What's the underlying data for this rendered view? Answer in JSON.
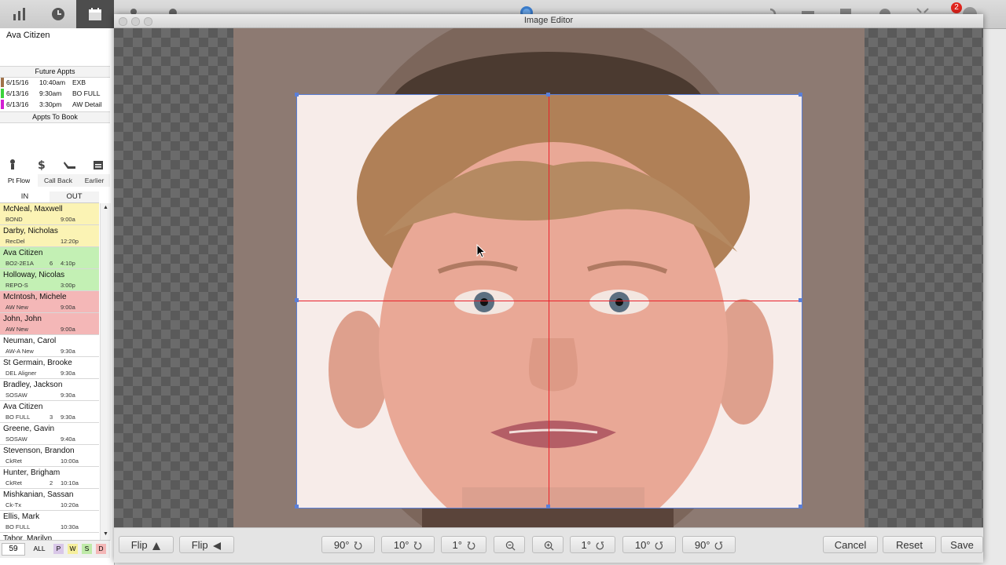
{
  "app": {
    "notification_count": "2"
  },
  "sidebar": {
    "patient_name": "Ava Citizen",
    "future_appts_header": "Future Appts",
    "future_appts": [
      {
        "date": "6/15/16",
        "time": "10:40am",
        "type": "EXB",
        "color": "#a0724a"
      },
      {
        "date": "6/13/16",
        "time": "9:30am",
        "type": "BO FULL",
        "color": "#3bd23b"
      },
      {
        "date": "6/13/16",
        "time": "3:30pm",
        "type": "AW Detail",
        "color": "#d21ed2"
      }
    ],
    "appts_to_book_header": "Appts To Book",
    "action_tabs": [
      "Pt Flow",
      "Call Back",
      "Earlier"
    ],
    "in_label": "IN",
    "out_label": "OUT",
    "patients": [
      {
        "name": "McNeal, Maxwell",
        "type": "BOND",
        "chair": "",
        "time": "9:00a",
        "color": "#fbf3b4"
      },
      {
        "name": "Darby, Nicholas",
        "type": "RecDel",
        "chair": "",
        "time": "12:20p",
        "color": "#fbf3b4"
      },
      {
        "name": "Ava Citizen",
        "type": "BO2-2E1A",
        "chair": "6",
        "time": "4:10p",
        "color": "#c3f0b4"
      },
      {
        "name": "Holloway, Nicolas",
        "type": "REPO-S",
        "chair": "",
        "time": "3:00p",
        "color": "#c3f0b4"
      },
      {
        "name": "McIntosh, Michele",
        "type": "AW New",
        "chair": "",
        "time": "9:00a",
        "color": "#f4b7b7"
      },
      {
        "name": "John, John",
        "type": "AW New",
        "chair": "",
        "time": "9:00a",
        "color": "#f4b7b7"
      },
      {
        "name": "Neuman, Carol",
        "type": "AW-A New",
        "chair": "",
        "time": "9:30a",
        "color": "#ffffff"
      },
      {
        "name": "St Germain, Brooke",
        "type": "DEL Aligner",
        "chair": "",
        "time": "9:30a",
        "color": "#ffffff"
      },
      {
        "name": "Bradley, Jackson",
        "type": "SOSAW",
        "chair": "",
        "time": "9:30a",
        "color": "#ffffff"
      },
      {
        "name": "Ava Citizen",
        "type": "BO FULL",
        "chair": "3",
        "time": "9:30a",
        "color": "#ffffff"
      },
      {
        "name": "Greene, Gavin",
        "type": "SOSAW",
        "chair": "",
        "time": "9:40a",
        "color": "#ffffff"
      },
      {
        "name": "Stevenson, Brandon",
        "type": "CkRet",
        "chair": "",
        "time": "10:00a",
        "color": "#ffffff"
      },
      {
        "name": "Hunter, Brigham",
        "type": "CkRet",
        "chair": "2",
        "time": "10:10a",
        "color": "#ffffff"
      },
      {
        "name": "Mishkanian, Sassan",
        "type": "Ck-Tx",
        "chair": "",
        "time": "10:20a",
        "color": "#ffffff"
      },
      {
        "name": "Ellis, Mark",
        "type": "BO FULL",
        "chair": "",
        "time": "10:30a",
        "color": "#ffffff"
      },
      {
        "name": "Tabor, Marilyn",
        "type": "",
        "chair": "",
        "time": "",
        "color": "#ffffff"
      }
    ],
    "count": "59",
    "filters": [
      {
        "label": "ALL",
        "color": "#efefef"
      },
      {
        "label": "P",
        "color": "#d9c7e8"
      },
      {
        "label": "W",
        "color": "#f6ef9c"
      },
      {
        "label": "S",
        "color": "#bfeaa8"
      },
      {
        "label": "D",
        "color": "#f4b7b7"
      }
    ]
  },
  "editor": {
    "title": "Image Editor",
    "buttons": {
      "flip_v": "Flip",
      "flip_h": "Flip",
      "rot_ccw_90": "90°",
      "rot_ccw_10": "10°",
      "rot_ccw_1": "1°",
      "rot_cw_1": "1°",
      "rot_cw_10": "10°",
      "rot_cw_90": "90°",
      "cancel": "Cancel",
      "reset": "Reset",
      "save": "Save"
    },
    "icons": {
      "flip_v": "flip-vertical-icon",
      "flip_h": "flip-horizontal-icon",
      "rotate_ccw": "rotate-ccw-icon",
      "rotate_cw": "rotate-cw-icon",
      "zoom_out": "zoom-out-icon",
      "zoom_in": "zoom-in-icon"
    },
    "colors": {
      "crop_border": "#5a7fd8",
      "guide_lines": "#e8202a"
    }
  }
}
